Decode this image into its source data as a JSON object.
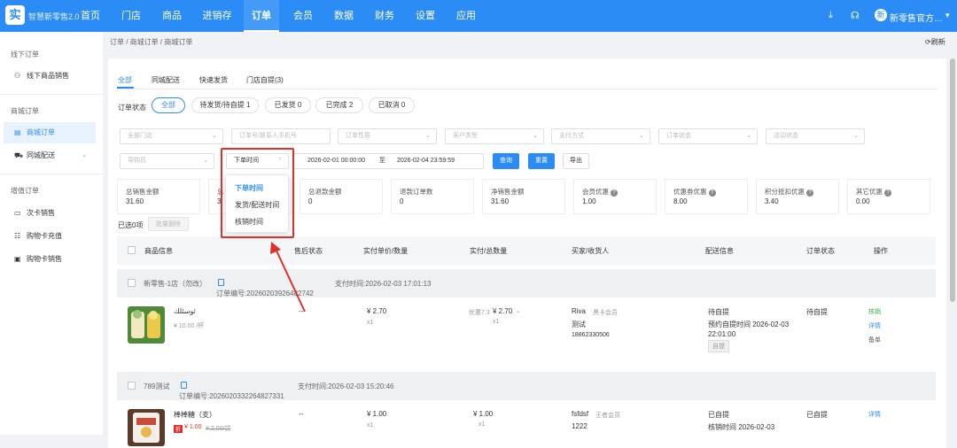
{
  "app": {
    "logo_char": "实",
    "name": "智慧新零售2.0"
  },
  "nav": [
    "首页",
    "门店",
    "商品",
    "进销存",
    "订单",
    "会员",
    "数据",
    "财务",
    "设置",
    "应用"
  ],
  "nav_active_index": 4,
  "user": {
    "avatar": "新",
    "name": "新零售官方…"
  },
  "topbar_icons": [
    "download-icon",
    "headset-icon"
  ],
  "sidebar": {
    "group1": "线下订单",
    "item_offline": "线下商品销售",
    "group2": "商城订单",
    "item_mall": "商城订单",
    "item_city": "同城配送",
    "group3": "增值订单",
    "item_card": "次卡销售",
    "item_recharge": "购物卡充值",
    "item_cardsale": "购物卡销售"
  },
  "breadcrumb": "订单 / 商城订单 / 商城订单",
  "refresh": "刷新",
  "tabs": [
    "全部",
    "同城配送",
    "快速发货",
    "门店自提(3)"
  ],
  "status": {
    "label": "订单状态",
    "pills": [
      "全部",
      "待发货/待自提 1",
      "已发货 0",
      "已完成 2",
      "已取消 0"
    ]
  },
  "filters": {
    "row1": [
      "全部门店",
      "订单号/联系人手机号",
      "订单性质",
      "客户类型",
      "支付方式",
      "订单状态",
      "活动状态"
    ],
    "row2_first": "导购员",
    "time_select": "下单时间"
  },
  "date": {
    "from": "2026-02-01 00:00:00",
    "sep": "至",
    "to": "2026-02-04 23:59:59"
  },
  "buttons": {
    "query": "查询",
    "reset": "重置",
    "export": "导出"
  },
  "stats": [
    {
      "label": "总销售金额",
      "value": "31.60",
      "help": false
    },
    {
      "label": "总",
      "value": "3",
      "help": false
    },
    {
      "label": "总退款金额",
      "value": "0",
      "help": false
    },
    {
      "label": "退款订单数",
      "value": "0",
      "help": false
    },
    {
      "label": "净销售金额",
      "value": "31.60",
      "help": false
    },
    {
      "label": "会员优惠",
      "value": "1.00",
      "help": true
    },
    {
      "label": "优惠券优惠",
      "value": "8.00",
      "help": true
    },
    {
      "label": "积分抵扣优惠",
      "value": "3.40",
      "help": true
    },
    {
      "label": "其它优惠",
      "value": "0.00",
      "help": true
    }
  ],
  "selection": {
    "selected": "已选0项",
    "batch_delete": "批量删除"
  },
  "table_headers": [
    "商品信息",
    "售后状态",
    "实付单价/数量",
    "实付/总数量",
    "买家/收货人",
    "配送信息",
    "订单状态",
    "操作"
  ],
  "orders": [
    {
      "store": "新零售-1店（勿改）",
      "order_no": "订单编号:20260203926482742",
      "pay_time": "支付时间:2026-02-03 17:01:13",
      "item": {
        "name": "ئوسئلك",
        "price": "¥ 10.00 /杯"
      },
      "after_sale": "--",
      "unit_price": "¥ 2.70",
      "unit_qty": "x1",
      "promo": "优惠7.3",
      "paid": "¥ 2.70",
      "paid_qty": "x1",
      "buyer": "Riva",
      "member": "黑卡会员",
      "receiver": "测试",
      "phone": "18862330506",
      "delivery": "待自提",
      "delivery_time": "预约自提时间 2026-02-03 22:01:00",
      "delivery_tag": "自提",
      "status": "待自提",
      "ops": [
        "核销",
        "详情",
        "备单"
      ]
    },
    {
      "store": "789测试",
      "order_no": "订单编号:2026020332264827331",
      "pay_time": "支付时间:2026-02-03 15:20:46",
      "item": {
        "name": "棒棒糖（支）",
        "tag": "折",
        "price": "¥ 1.00",
        "old_price": "¥ 2.00/袋"
      },
      "after_sale": "--",
      "unit_price": "¥ 1.00",
      "unit_qty": "x1",
      "paid": "¥ 1.00",
      "paid_qty": "x1",
      "buyer": "fsfdsf",
      "member": "王者会员",
      "receiver": "1222",
      "delivery": "已自提",
      "delivery_time": "核销时间 2026-02-03",
      "status": "已自提",
      "ops": [
        "详情"
      ]
    }
  ],
  "time_dropdown": {
    "options": [
      "下单时间",
      "发货/配送时间",
      "核销时间"
    ],
    "selected_index": 0
  },
  "colors": {
    "primary": "#2b8cf6",
    "highlight": "#e0302a",
    "success": "#36b54a"
  }
}
